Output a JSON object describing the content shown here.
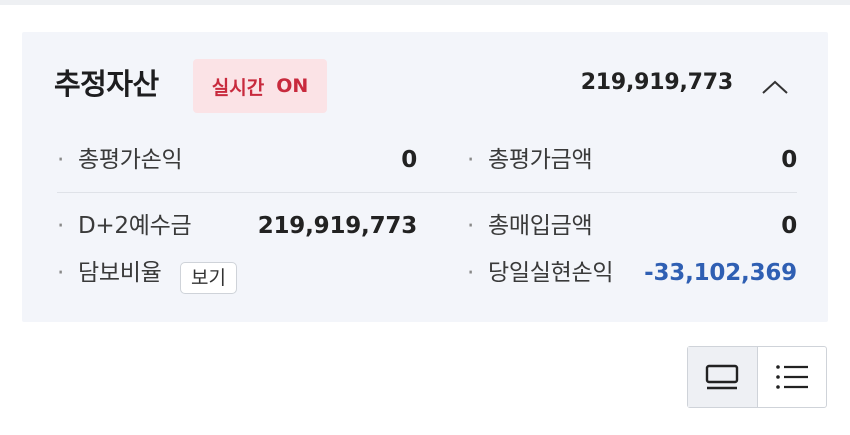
{
  "asset_card": {
    "title": "추정자산",
    "realtime": {
      "label": "실시간",
      "status": "ON"
    },
    "total_value": "219,919,773",
    "rows": [
      {
        "label": "총평가손익",
        "value": "0"
      },
      {
        "label": "총평가금액",
        "value": "0"
      },
      {
        "label": "D+2예수금",
        "value": "219,919,773"
      },
      {
        "label": "총매입금액",
        "value": "0"
      },
      {
        "label": "담보비율",
        "value": ""
      },
      {
        "label": "당일실현손익",
        "value": "-33,102,369"
      }
    ],
    "collateral_view_label": "보기"
  },
  "colors": {
    "realtime_badge_bg": "#fbe3e6",
    "realtime_text": "#c82a3d",
    "negative_value": "#2f5fb3",
    "card_bg": "#f3f5fa"
  },
  "view_toggle": {
    "options": [
      {
        "icon": "card-view-icon",
        "selected": true
      },
      {
        "icon": "list-view-icon",
        "selected": false
      }
    ]
  }
}
